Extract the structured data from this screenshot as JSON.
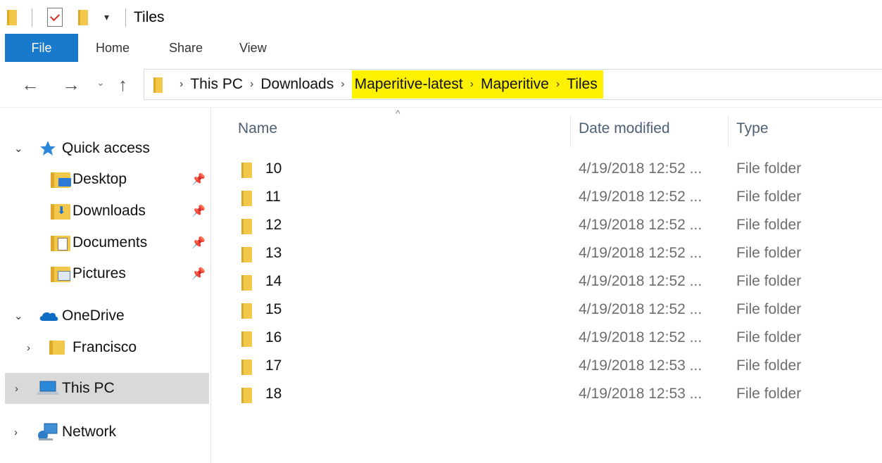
{
  "window": {
    "title": "Tiles",
    "qat_dropdown": "▾"
  },
  "ribbon": {
    "tabs": [
      {
        "label": "File"
      },
      {
        "label": "Home"
      },
      {
        "label": "Share"
      },
      {
        "label": "View"
      }
    ]
  },
  "navigation": {
    "back": "←",
    "forward": "→",
    "recent": "⌄",
    "up": "↑"
  },
  "address": {
    "separator": "›",
    "crumbs": [
      "This PC",
      "Downloads",
      "Maperitive-latest",
      "Maperitive",
      "Tiles"
    ],
    "highlight_color": "#fff200"
  },
  "sidebar": {
    "quick_access": {
      "label": "Quick access",
      "chevron": "⌄"
    },
    "pinned": [
      {
        "label": "Desktop",
        "icon": "desktop-folder-icon",
        "pin": "📌"
      },
      {
        "label": "Downloads",
        "icon": "downloads-folder-icon",
        "pin": "📌"
      },
      {
        "label": "Documents",
        "icon": "documents-folder-icon",
        "pin": "📌"
      },
      {
        "label": "Pictures",
        "icon": "pictures-folder-icon",
        "pin": "📌"
      }
    ],
    "onedrive": {
      "label": "OneDrive",
      "chevron": "⌄"
    },
    "francisco": {
      "label": "Francisco",
      "chevron": "›"
    },
    "this_pc": {
      "label": "This PC",
      "chevron": "›"
    },
    "network": {
      "label": "Network",
      "chevron": "›"
    }
  },
  "file_list": {
    "sort_indicator": "^",
    "columns": {
      "name": "Name",
      "date": "Date modified",
      "type": "Type"
    },
    "rows": [
      {
        "name": "10",
        "date": "4/19/2018 12:52 ...",
        "type": "File folder"
      },
      {
        "name": "11",
        "date": "4/19/2018 12:52 ...",
        "type": "File folder"
      },
      {
        "name": "12",
        "date": "4/19/2018 12:52 ...",
        "type": "File folder"
      },
      {
        "name": "13",
        "date": "4/19/2018 12:52 ...",
        "type": "File folder"
      },
      {
        "name": "14",
        "date": "4/19/2018 12:52 ...",
        "type": "File folder"
      },
      {
        "name": "15",
        "date": "4/19/2018 12:52 ...",
        "type": "File folder"
      },
      {
        "name": "16",
        "date": "4/19/2018 12:52 ...",
        "type": "File folder"
      },
      {
        "name": "17",
        "date": "4/19/2018 12:53 ...",
        "type": "File folder"
      },
      {
        "name": "18",
        "date": "4/19/2018 12:53 ...",
        "type": "File folder"
      }
    ]
  },
  "colors": {
    "file_tab": "#1979ca",
    "folder": "#f3c84a",
    "selected": "#d9d9d9"
  }
}
